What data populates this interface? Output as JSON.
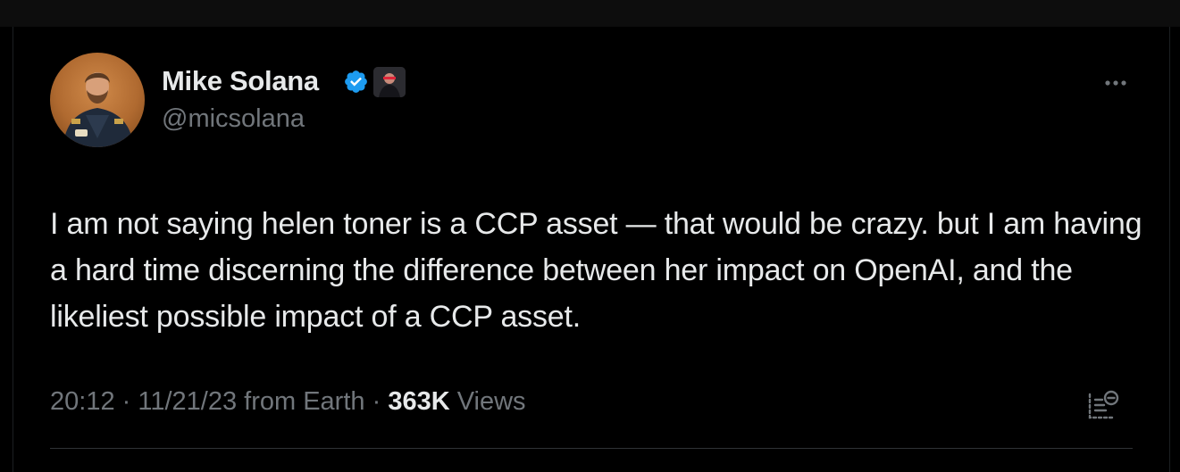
{
  "author": {
    "display_name": "Mike Solana",
    "handle": "@micsolana",
    "verified": true,
    "verified_color": "#1d9bf0"
  },
  "post": {
    "text": "I am not saying helen toner is a CCP asset — that would be crazy. but I am having a hard time discerning the difference between her impact on OpenAI, and the likeliest possible impact of a CCP asset.",
    "time": "20:12",
    "date": "11/21/23",
    "location": "from Earth",
    "views_count": "363K",
    "views_label": "Views"
  },
  "icons": {
    "more": "more-horizontal-icon",
    "verified": "verified-badge-icon",
    "analytics": "view-quotes-icon"
  },
  "colors": {
    "background": "#000000",
    "text_primary": "#e7e9ea",
    "text_secondary": "#71767b",
    "divider": "#2f3336"
  }
}
